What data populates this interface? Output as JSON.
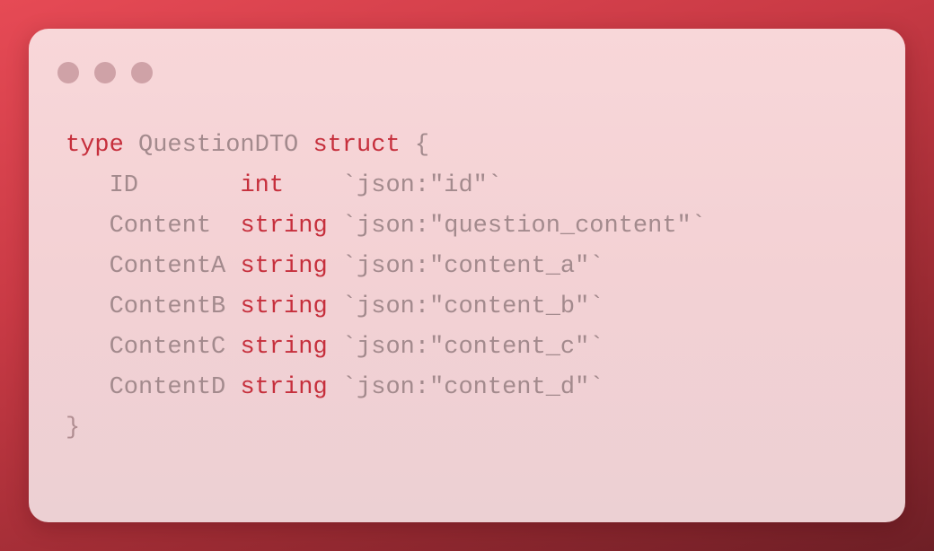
{
  "window": {
    "controls": [
      "close-dot",
      "minimize-dot",
      "maximize-dot"
    ]
  },
  "code": {
    "header": {
      "keyword": "type",
      "name": "QuestionDTO",
      "kind": "struct",
      "open_brace": "{"
    },
    "fields": [
      {
        "name": "ID       ",
        "type": "int   ",
        "tag": "`json:\"id\"`"
      },
      {
        "name": "Content  ",
        "type": "string",
        "tag": "`json:\"question_content\"`"
      },
      {
        "name": "ContentA ",
        "type": "string",
        "tag": "`json:\"content_a\"`"
      },
      {
        "name": "ContentB ",
        "type": "string",
        "tag": "`json:\"content_b\"`"
      },
      {
        "name": "ContentC ",
        "type": "string",
        "tag": "`json:\"content_c\"`"
      },
      {
        "name": "ContentD ",
        "type": "string",
        "tag": "`json:\"content_d\"`"
      }
    ],
    "close_brace": "}"
  },
  "colors": {
    "keyword": "#c62f3c",
    "identifier": "#a38a8d",
    "window_bg": "#f5d4d7",
    "dots": "#cfa2a7"
  }
}
